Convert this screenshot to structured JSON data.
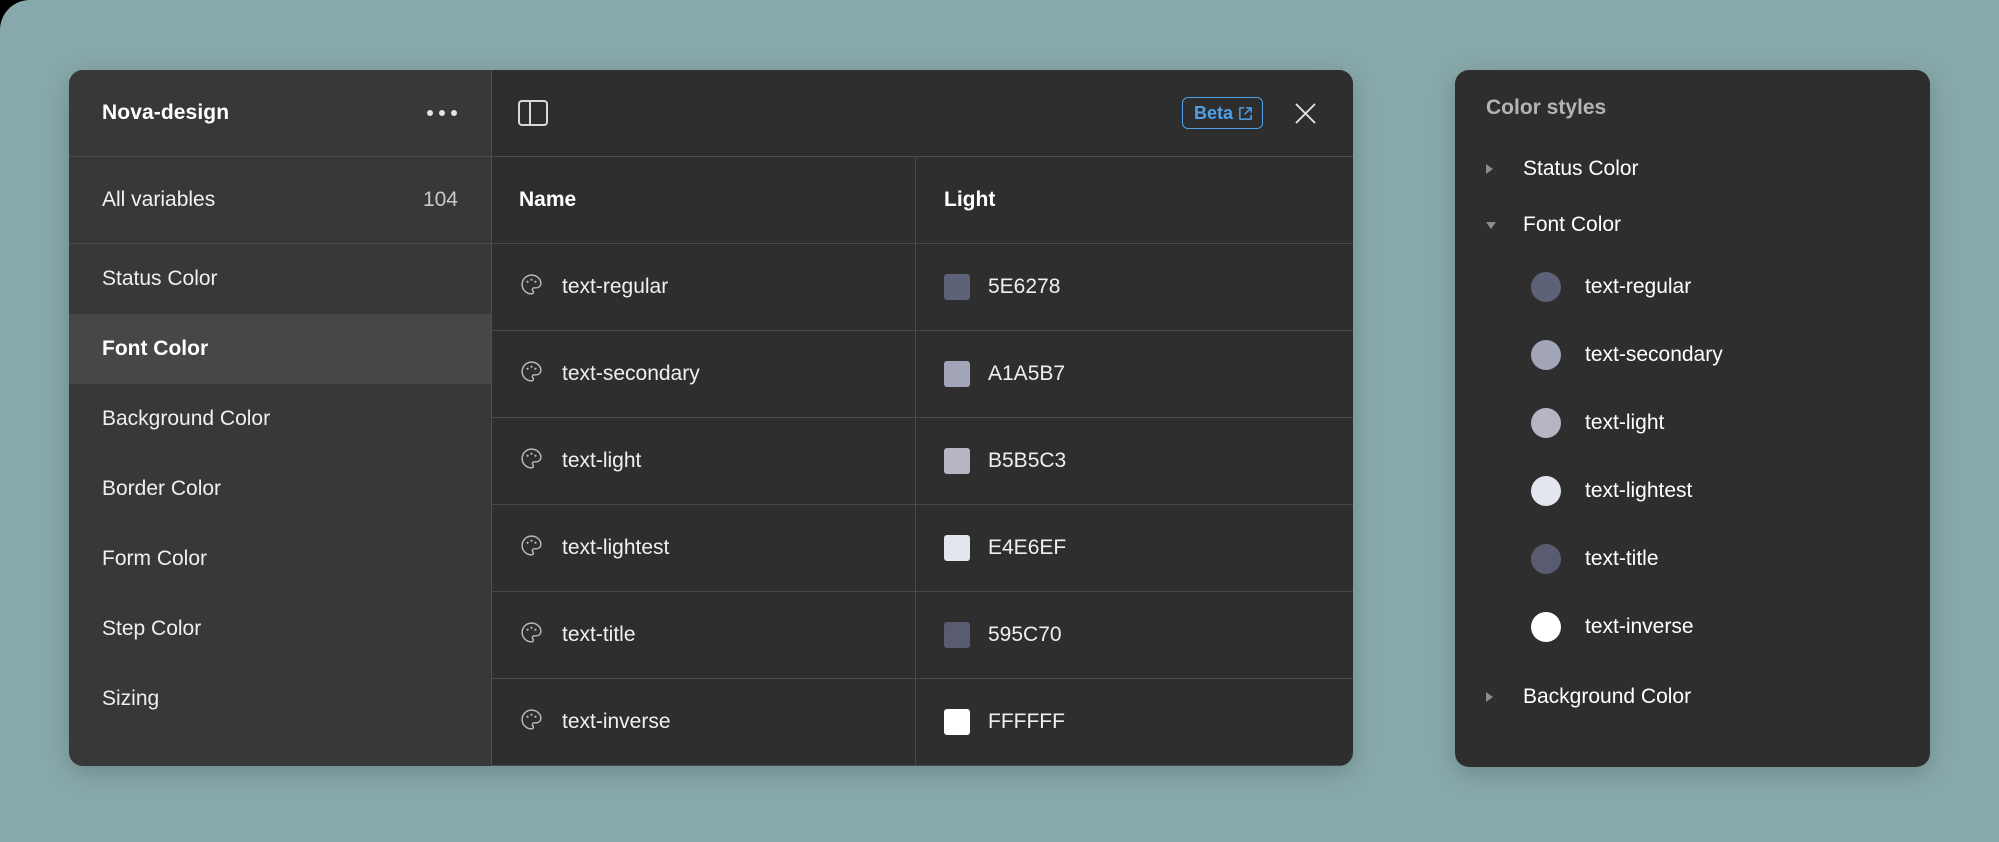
{
  "canvas": {
    "background_color": "#88a9ab"
  },
  "variables_window": {
    "title": "Nova-design",
    "overflow_icon": "more-horizontal-icon",
    "all_variables": {
      "label": "All variables",
      "count": "104"
    },
    "nav_items": [
      {
        "label": "Status Color",
        "selected": false
      },
      {
        "label": "Font Color",
        "selected": true
      },
      {
        "label": "Background Color",
        "selected": false
      },
      {
        "label": "Border Color",
        "selected": false
      },
      {
        "label": "Form Color",
        "selected": false
      },
      {
        "label": "Step Color",
        "selected": false
      },
      {
        "label": "Sizing",
        "selected": false
      }
    ],
    "toolbar": {
      "panel_toggle_icon": "sidebar-panel-icon",
      "beta_label": "Beta",
      "beta_icon": "external-link-icon",
      "close_icon": "close-icon"
    },
    "table": {
      "columns": [
        "Name",
        "Light"
      ],
      "rows": [
        {
          "icon": "palette-icon",
          "name": "text-regular",
          "hex": "5E6278",
          "swatch": "#5E6278"
        },
        {
          "icon": "palette-icon",
          "name": "text-secondary",
          "hex": "A1A5B7",
          "swatch": "#A1A5B7"
        },
        {
          "icon": "palette-icon",
          "name": "text-light",
          "hex": "B5B5C3",
          "swatch": "#B5B5C3"
        },
        {
          "icon": "palette-icon",
          "name": "text-lightest",
          "hex": "E4E6EF",
          "swatch": "#E4E6EF"
        },
        {
          "icon": "palette-icon",
          "name": "text-title",
          "hex": "595C70",
          "swatch": "#595C70"
        },
        {
          "icon": "palette-icon",
          "name": "text-inverse",
          "hex": "FFFFFF",
          "swatch": "#FFFFFF"
        }
      ]
    }
  },
  "color_styles_panel": {
    "title": "Color styles",
    "groups_before": [
      {
        "label": "Status Color",
        "expanded": false
      }
    ],
    "expanded_group": {
      "label": "Font Color",
      "expanded": true
    },
    "expanded_items": [
      {
        "label": "text-regular",
        "color": "#5E6278"
      },
      {
        "label": "text-secondary",
        "color": "#A1A5B7"
      },
      {
        "label": "text-light",
        "color": "#B5B5C3"
      },
      {
        "label": "text-lightest",
        "color": "#E4E6EF"
      },
      {
        "label": "text-title",
        "color": "#595C70"
      },
      {
        "label": "text-inverse",
        "color": "#FFFFFF"
      }
    ],
    "groups_after": [
      {
        "label": "Background Color",
        "expanded": false
      }
    ]
  }
}
